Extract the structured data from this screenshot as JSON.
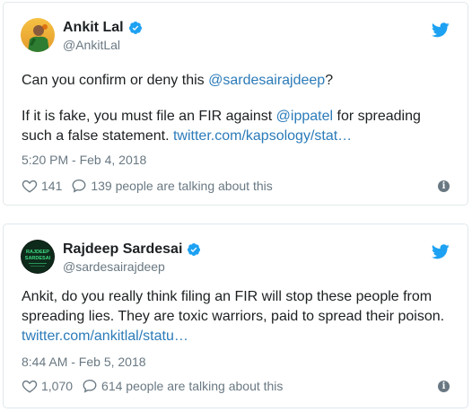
{
  "tweets": [
    {
      "author": "Ankit Lal",
      "handle": "@AnkitLal",
      "text1_prefix": "Can you confirm or deny this ",
      "text1_mention": "@sardesairajdeep",
      "text1_suffix": "?",
      "text2_prefix": "If it is fake, you must file an FIR against ",
      "text2_mention": "@ippatel",
      "text2_middle": " for spreading such a false statement. ",
      "text2_link": "twitter.com/kapsology/stat…",
      "timestamp": "5:20 PM - Feb 4, 2018",
      "likes": "141",
      "talking": "139 people are talking about this"
    },
    {
      "author": "Rajdeep Sardesai",
      "handle": "@sardesairajdeep",
      "avatar_text_top": "RAJDEEP",
      "avatar_text_bottom": "SARDESAI",
      "text_main": "Ankit, do you really think filing an FIR will stop these people from spreading lies. They are toxic warriors, paid to spread their poison. ",
      "text_link": "twitter.com/ankitlal/statu…",
      "timestamp": "8:44 AM - Feb 5, 2018",
      "likes": "1,070",
      "talking": "614 people are talking about this"
    }
  ],
  "colors": {
    "link": "#2b7bb9",
    "verified": "#1da1f2",
    "twitter_blue": "#1da1f2",
    "muted": "#697882",
    "border": "#e1e8ed"
  },
  "icons": {
    "brand": "twitter-bird-icon",
    "verified": "verified-badge-icon",
    "like": "heart-icon",
    "reply": "speech-bubble-icon",
    "info": "info-icon"
  }
}
